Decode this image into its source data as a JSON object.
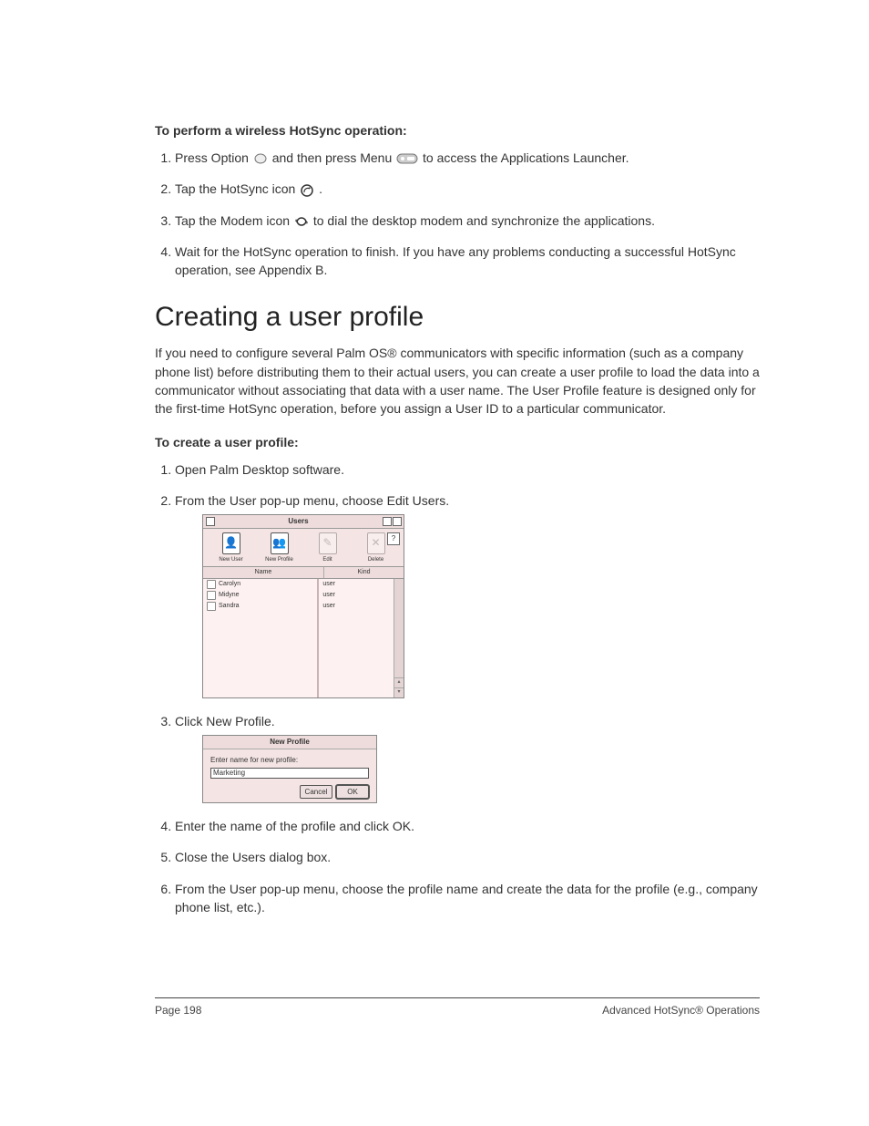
{
  "sectionA": {
    "title": "To perform a wireless HotSync operation:",
    "steps": [
      {
        "pre": "Press Option ",
        "mid1": " and then press Menu ",
        "post": " to access the Applications Launcher."
      },
      {
        "pre": "Tap the HotSync icon ",
        "post": "."
      },
      {
        "pre": "Tap the Modem icon ",
        "post": " to dial the desktop modem and synchronize the applications."
      },
      {
        "text": "Wait for the HotSync operation to finish. If you have any problems conducting a successful HotSync operation, see Appendix B."
      }
    ]
  },
  "heading": "Creating a user profile",
  "intro": "If you need to configure several Palm OS® communicators with specific information (such as a company phone list) before distributing them to their actual users, you can create a user profile to load the data into a communicator without associating that data with a user name. The User Profile feature is designed only for the first-time HotSync operation, before you assign a User ID to a particular communicator.",
  "sectionB": {
    "title": "To create a user profile:",
    "step1": "Open Palm Desktop software.",
    "step2": "From the User pop-up menu, choose Edit Users.",
    "step3": "Click New Profile.",
    "step4": "Enter the name of the profile and click OK.",
    "step5": "Close the Users dialog box.",
    "step6": "From the User pop-up menu, choose the profile name and create the data for the profile (e.g., company phone list, etc.)."
  },
  "usersDialog": {
    "title": "Users",
    "help": "?",
    "tools": [
      {
        "label": "New User"
      },
      {
        "label": "New Profile"
      },
      {
        "label": "Edit"
      },
      {
        "label": "Delete"
      }
    ],
    "col_name": "Name",
    "col_kind": "Kind",
    "rows": [
      {
        "name": "Carolyn",
        "kind": "user"
      },
      {
        "name": "Midyne",
        "kind": "user"
      },
      {
        "name": "Sandra",
        "kind": "user"
      }
    ]
  },
  "newProfile": {
    "title": "New Profile",
    "label": "Enter name for new profile:",
    "value": "Marketing",
    "cancel": "Cancel",
    "ok": "OK"
  },
  "footer": {
    "left": "Page 198",
    "right": "Advanced HotSync® Operations"
  }
}
